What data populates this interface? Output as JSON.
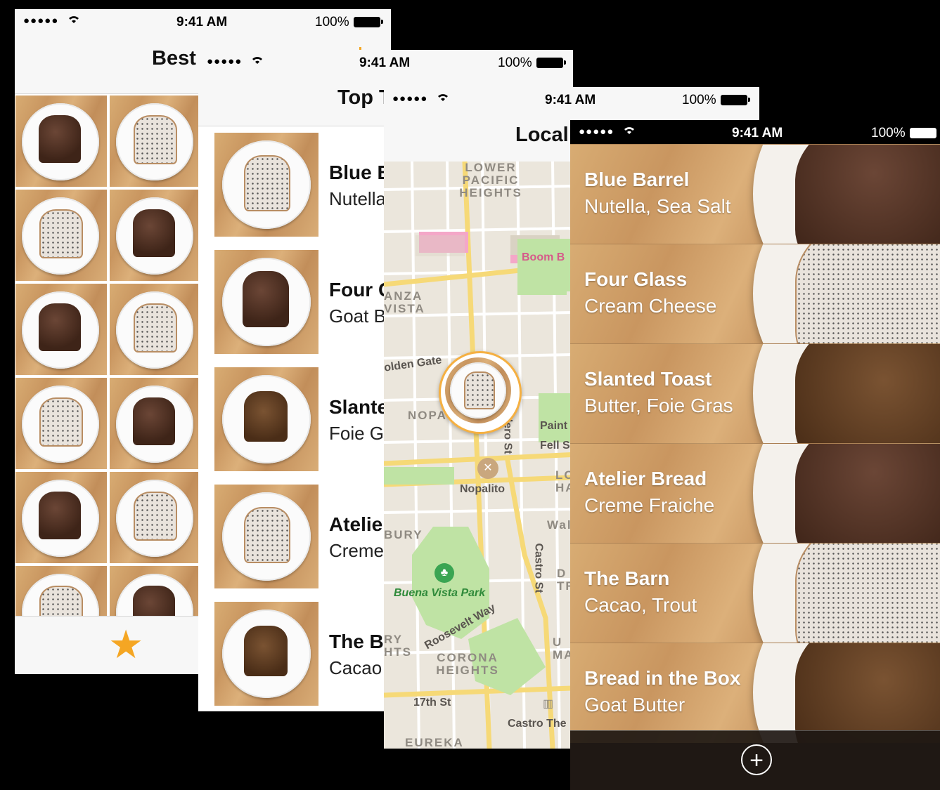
{
  "status_bar": {
    "signal": "●●●●●",
    "time": "9:41 AM",
    "battery": "100%"
  },
  "screens": {
    "best": {
      "title": "Best"
    },
    "top": {
      "title": "Top T",
      "rows": [
        {
          "name": "Blue B",
          "sub": "Nutella"
        },
        {
          "name": "Four G",
          "sub": "Goat B"
        },
        {
          "name": "Slante",
          "sub": "Foie G"
        },
        {
          "name": "Atelie",
          "sub": "Creme"
        },
        {
          "name": "The B",
          "sub": "Cacao"
        }
      ]
    },
    "local": {
      "title": "Local",
      "map_labels": {
        "lower_pacific": "LOWER PACIFIC HEIGHTS",
        "anza_vista": "ANZA VISTA",
        "nopa": "NOPA",
        "golden_gate": "olden Gate",
        "boom": "Boom B",
        "nopalito": "Nopalito",
        "divisadero": "dero St",
        "paint": "Paint",
        "fell": "Fell S",
        "lo": "LO HA",
        "wal": "Wal",
        "d_tr": "D TR",
        "u_ma": "U MA",
        "bury": "BURY",
        "hts": "RY HTS",
        "buena_vista": "Buena Vista Park",
        "roosevelt": "Roosevelt Way",
        "corona": "CORONA HEIGHTS",
        "castro_st": "Castro St",
        "seventeenth": "17th St",
        "castro_the": "Castro The",
        "eureka": "EUREKA"
      }
    },
    "list": {
      "rows": [
        {
          "name": "Blue Barrel",
          "sub": "Nutella, Sea Salt",
          "kind": "choc"
        },
        {
          "name": "Four Glass",
          "sub": "Cream Cheese",
          "kind": "cream"
        },
        {
          "name": "Slanted Toast",
          "sub": "Butter, Foie Gras",
          "kind": "plain"
        },
        {
          "name": "Atelier Bread",
          "sub": "Creme Fraiche",
          "kind": "choc"
        },
        {
          "name": "The Barn",
          "sub": "Cacao, Trout",
          "kind": "cream"
        },
        {
          "name": "Bread in the Box",
          "sub": "Goat Butter",
          "kind": "plain"
        }
      ],
      "add_icon": "plus-circle-icon"
    }
  },
  "colors": {
    "accent": "#f5a623",
    "map_green": "#bfe3a4",
    "map_road": "#f6d977"
  }
}
